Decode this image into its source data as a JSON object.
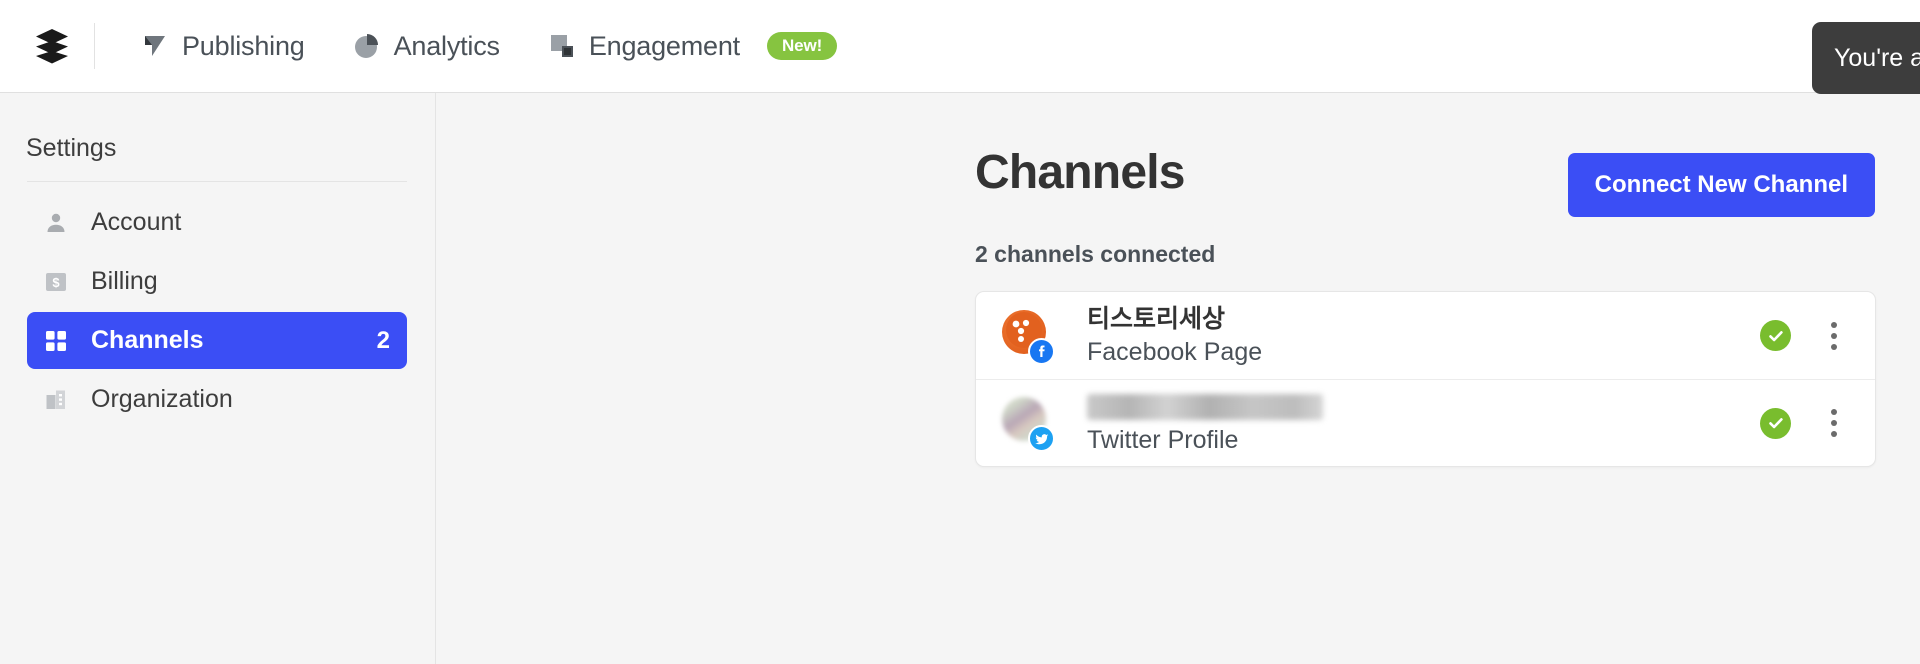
{
  "topnav": {
    "logo_icon": "buffer-layers-icon",
    "items": [
      {
        "label": "Publishing",
        "icon": "publishing-flag-icon"
      },
      {
        "label": "Analytics",
        "icon": "analytics-pie-icon"
      },
      {
        "label": "Engagement",
        "icon": "engagement-squares-icon",
        "badge": "New!"
      }
    ]
  },
  "tooltip": {
    "text": "You're a connec"
  },
  "sidebar": {
    "title": "Settings",
    "items": [
      {
        "label": "Account",
        "icon": "person-icon",
        "count": "",
        "active": false
      },
      {
        "label": "Billing",
        "icon": "dollar-card-icon",
        "count": "",
        "active": false
      },
      {
        "label": "Channels",
        "icon": "grid-squares-icon",
        "count": "2",
        "active": true
      },
      {
        "label": "Organization",
        "icon": "building-icon",
        "count": "",
        "active": false
      }
    ]
  },
  "main": {
    "title": "Channels",
    "connect_button": "Connect New Channel",
    "subtitle": "2 channels connected",
    "channels": [
      {
        "name": "티스토리세상",
        "type": "Facebook Page",
        "network": "facebook",
        "status_icon": "check-circle-icon",
        "menu_icon": "kebab-menu-icon",
        "redacted": false
      },
      {
        "name": "",
        "type": "Twitter Profile",
        "network": "twitter",
        "status_icon": "check-circle-icon",
        "menu_icon": "kebab-menu-icon",
        "redacted": true
      }
    ]
  },
  "colors": {
    "accent_blue": "#3b4ef5",
    "badge_green": "#86c440",
    "status_green": "#79bd2e",
    "facebook_blue": "#1877f2",
    "twitter_blue": "#1da1f2",
    "page_bg": "#f5f5f5"
  }
}
